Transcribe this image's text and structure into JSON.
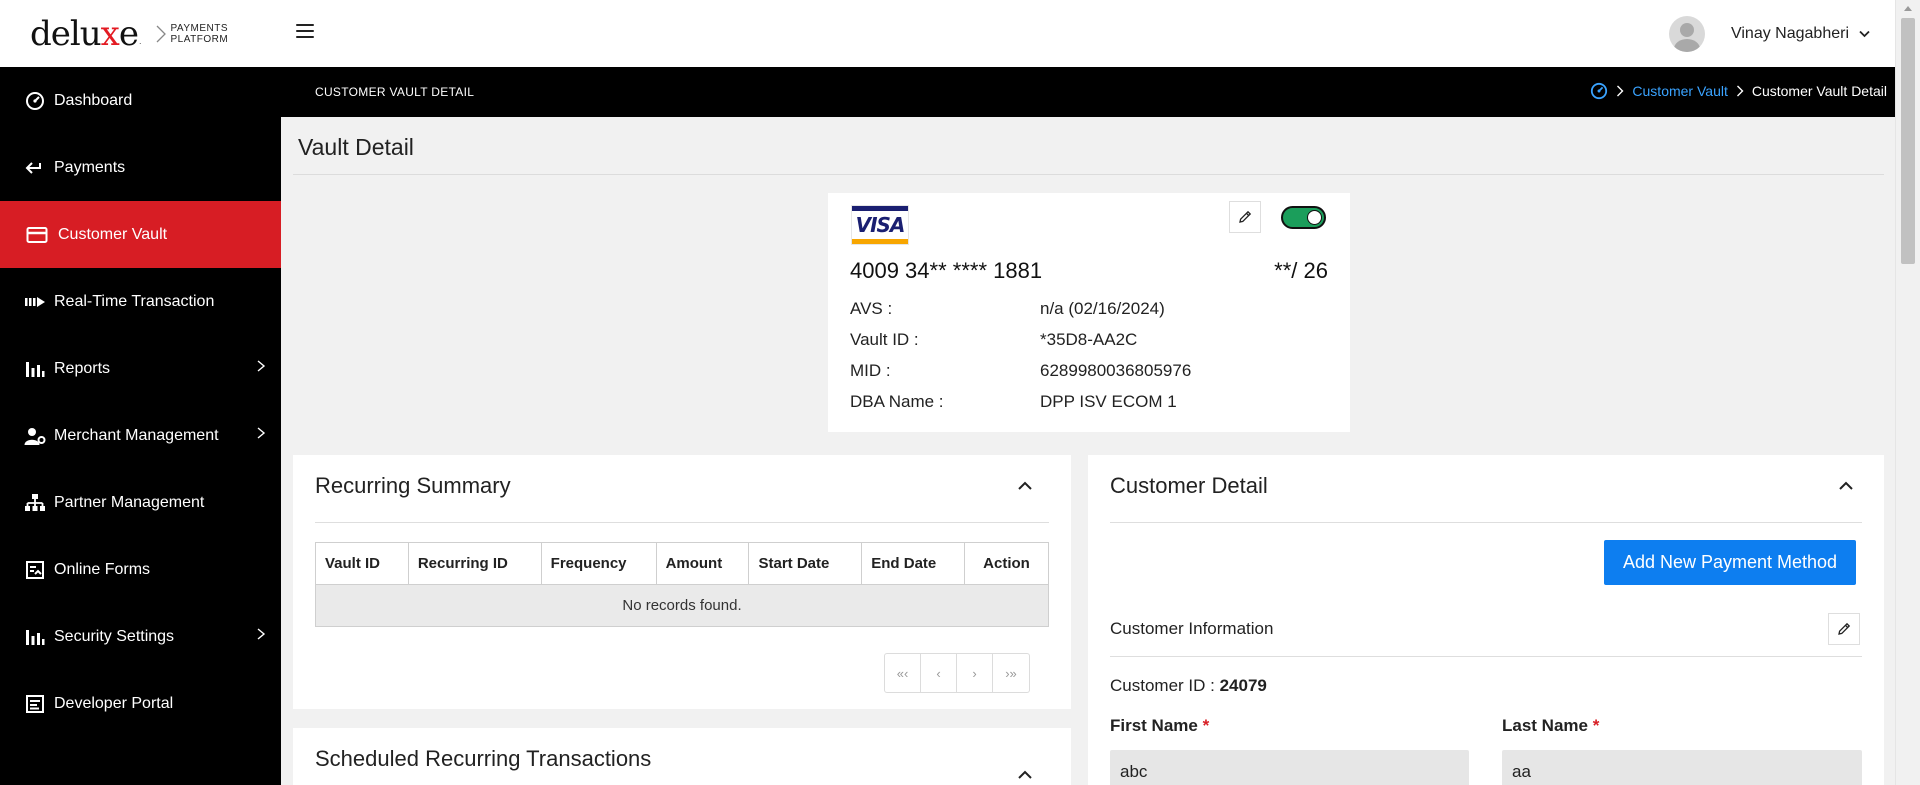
{
  "header": {
    "logo_word_pre": "delu",
    "logo_word_x": "x",
    "logo_word_post": "e",
    "logo_reg": ".",
    "logo_sub_line1": "PAYMENTS",
    "logo_sub_line2": "PLATFORM",
    "user_name": "Vinay Nagabheri"
  },
  "sidebar": {
    "items": [
      {
        "label": "Dashboard",
        "icon": "dashboard-icon"
      },
      {
        "label": "Payments",
        "icon": "payments-arrow-icon"
      },
      {
        "label": "Customer Vault",
        "icon": "card-icon",
        "active": true
      },
      {
        "label": "Real-Time Transaction",
        "icon": "realtime-icon"
      },
      {
        "label": "Reports",
        "icon": "bar-chart-icon",
        "has_children": true
      },
      {
        "label": "Merchant Management",
        "icon": "user-gear-icon",
        "has_children": true
      },
      {
        "label": "Partner Management",
        "icon": "org-chart-icon"
      },
      {
        "label": "Online Forms",
        "icon": "form-icon"
      },
      {
        "label": "Security Settings",
        "icon": "bar-chart-icon",
        "has_children": true
      },
      {
        "label": "Developer Portal",
        "icon": "developer-icon"
      }
    ]
  },
  "subheader": {
    "title": "CUSTOMER VAULT DETAIL",
    "breadcrumb": {
      "link": "Customer Vault",
      "current": "Customer Vault Detail"
    }
  },
  "page": {
    "title": "Vault Detail"
  },
  "card": {
    "brand": "VISA",
    "number": "4009 34** **** 1881",
    "expiry": "**/ 26",
    "enabled": true,
    "details": [
      {
        "key": "AVS :",
        "value": "n/a (02/16/2024)"
      },
      {
        "key": "Vault ID :",
        "value": "*35D8-AA2C"
      },
      {
        "key": "MID :",
        "value": "6289980036805976"
      },
      {
        "key": "DBA Name :",
        "value": "DPP ISV ECOM 1"
      }
    ]
  },
  "recurring_summary": {
    "title": "Recurring Summary",
    "columns": [
      "Vault ID",
      "Recurring ID",
      "Frequency",
      "Amount",
      "Start Date",
      "End Date",
      "Action"
    ],
    "empty_message": "No records found.",
    "pager": [
      "«‹",
      "‹",
      "›",
      "›»"
    ]
  },
  "scheduled": {
    "title": "Scheduled Recurring Transactions"
  },
  "customer_detail": {
    "title": "Customer Detail",
    "add_button": "Add New Payment Method",
    "info_title": "Customer Information",
    "customer_id_label": "Customer ID : ",
    "customer_id": "24079",
    "first_name_label": "First Name",
    "last_name_label": "Last Name",
    "required_mark": "*",
    "first_name": "abc",
    "last_name": "aa"
  },
  "colors": {
    "brand_red": "#d71d24",
    "link_blue": "#3aa3ff",
    "button_blue": "#0d7ef0",
    "toggle_green": "#1b9e5b"
  }
}
